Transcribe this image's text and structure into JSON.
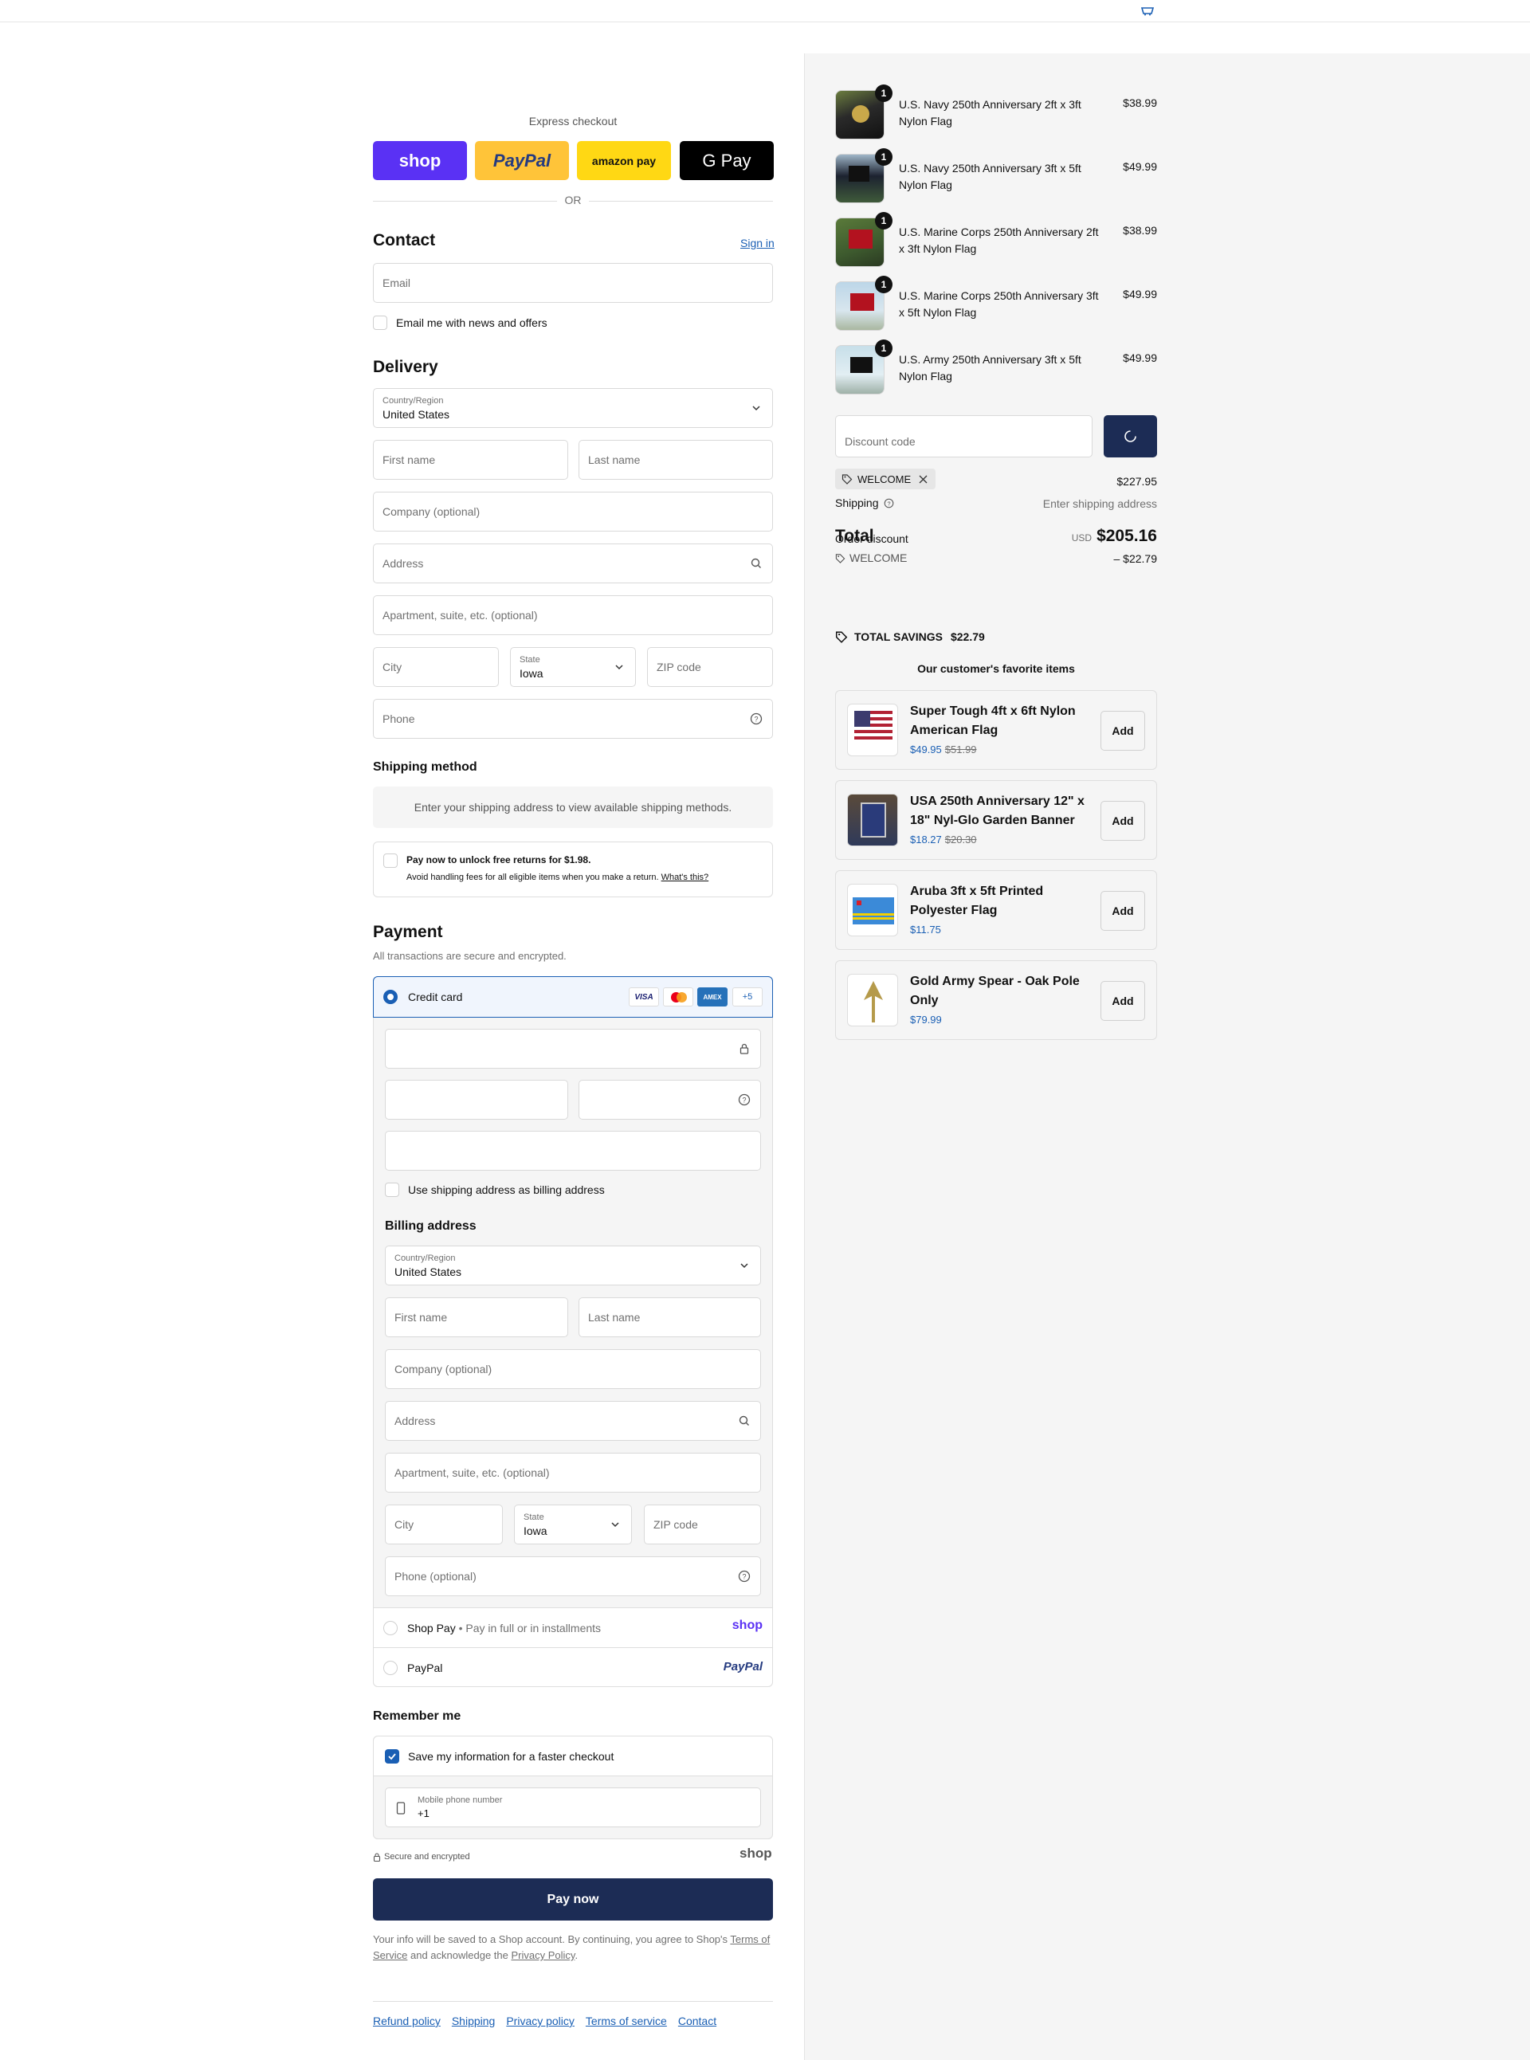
{
  "express": {
    "heading": "Express checkout",
    "shop_label": "shop",
    "paypal_label": "PayPal",
    "amazon_label": "amazon pay",
    "gpay_label": "G Pay",
    "or_label": "OR"
  },
  "contact": {
    "heading": "Contact",
    "signin_label": "Sign in",
    "email_placeholder": "Email",
    "newsletter_label": "Email me with news and offers"
  },
  "delivery": {
    "heading": "Delivery",
    "country_label": "Country/Region",
    "country_value": "United States",
    "first_name": "First name",
    "last_name": "Last name",
    "company": "Company (optional)",
    "address": "Address",
    "apartment": "Apartment, suite, etc. (optional)",
    "city": "City",
    "state_label": "State",
    "state_value": "Iowa",
    "zip": "ZIP code",
    "phone": "Phone"
  },
  "shipping_method": {
    "heading": "Shipping method",
    "notice": "Enter your shipping address to view available shipping methods."
  },
  "returns": {
    "title": "Pay now to unlock free returns for $1.98.",
    "desc": "Avoid handling fees for all eligible items when you make a return.",
    "link": "What's this?"
  },
  "payment": {
    "heading": "Payment",
    "subtitle": "All transactions are secure and encrypted.",
    "credit_card_label": "Credit card",
    "card_more": "+5",
    "card_brands": [
      "VISA",
      "Mastercard",
      "AMEX"
    ],
    "billing_checkbox_label": "Use shipping address as billing address",
    "billing_heading": "Billing address",
    "billing": {
      "country_label": "Country/Region",
      "country_value": "United States",
      "first_name": "First name",
      "last_name": "Last name",
      "company": "Company (optional)",
      "address": "Address",
      "apartment": "Apartment, suite, etc. (optional)",
      "city": "City",
      "state_label": "State",
      "state_value": "Iowa",
      "zip": "ZIP code",
      "phone": "Phone (optional)"
    },
    "shoppay_label": "Shop Pay",
    "shoppay_sub": "Pay in full or in installments",
    "shoppay_logo": "shop",
    "paypal_label": "PayPal",
    "paypal_logo": "PayPal"
  },
  "remember": {
    "heading": "Remember me",
    "save_label": "Save my information for a faster checkout",
    "mobile_label": "Mobile phone number",
    "mobile_value": "+1",
    "secure_label": "Secure and encrypted",
    "shop_logo": "shop"
  },
  "pay_now_label": "Pay now",
  "legal": {
    "text1": "Your info will be saved to a Shop account. By continuing, you agree to Shop's",
    "tos": "Terms of Service",
    "text2": "and acknowledge the",
    "privacy": "Privacy Policy",
    "text3": "."
  },
  "footer_links": [
    "Refund policy",
    "Shipping",
    "Privacy policy",
    "Terms of service",
    "Contact"
  ],
  "cart_items": [
    {
      "name": "U.S. Navy 250th Anniversary 2ft x 3ft Nylon Flag",
      "price": "$38.99",
      "qty": "1"
    },
    {
      "name": "U.S. Navy 250th Anniversary 3ft x 5ft Nylon Flag",
      "price": "$49.99",
      "qty": "1"
    },
    {
      "name": "U.S. Marine Corps 250th Anniversary 2ft x 3ft Nylon Flag",
      "price": "$38.99",
      "qty": "1"
    },
    {
      "name": "U.S. Marine Corps 250th Anniversary 3ft x 5ft Nylon Flag",
      "price": "$49.99",
      "qty": "1"
    },
    {
      "name": "U.S. Army 250th Anniversary 3ft x 5ft Nylon Flag",
      "price": "$49.99",
      "qty": "1"
    }
  ],
  "summary": {
    "discount_placeholder": "Discount code",
    "applied_code": "WELCOME",
    "subtotal": "$227.95",
    "shipping_label": "Shipping",
    "shipping_value": "Enter shipping address",
    "total_label": "Total",
    "currency": "USD",
    "total": "$205.16",
    "order_discount_label": "Order discount",
    "discount_code": "WELCOME",
    "discount_amount": "– $22.79",
    "savings_label": "TOTAL SAVINGS",
    "savings_value": "$22.79"
  },
  "recommendations": {
    "heading": "Our customer's favorite items",
    "items": [
      {
        "name": "Super Tough 4ft x 6ft Nylon American Flag",
        "price": "$49.95",
        "old_price": "$51.99",
        "add": "Add"
      },
      {
        "name": "USA 250th Anniversary 12\" x 18\" Nyl-Glo Garden Banner",
        "price": "$18.27",
        "old_price": "$20.30",
        "add": "Add"
      },
      {
        "name": "Aruba 3ft x 5ft Printed Polyester Flag",
        "price": "$11.75",
        "old_price": "",
        "add": "Add"
      },
      {
        "name": "Gold Army Spear - Oak Pole Only",
        "price": "$79.99",
        "old_price": "",
        "add": "Add"
      }
    ]
  },
  "colors": {
    "accent": "#1a5fb4",
    "pay_button": "#1c2c55",
    "shop_purple": "#5a31f4",
    "paypal_yellow": "#ffc439"
  }
}
